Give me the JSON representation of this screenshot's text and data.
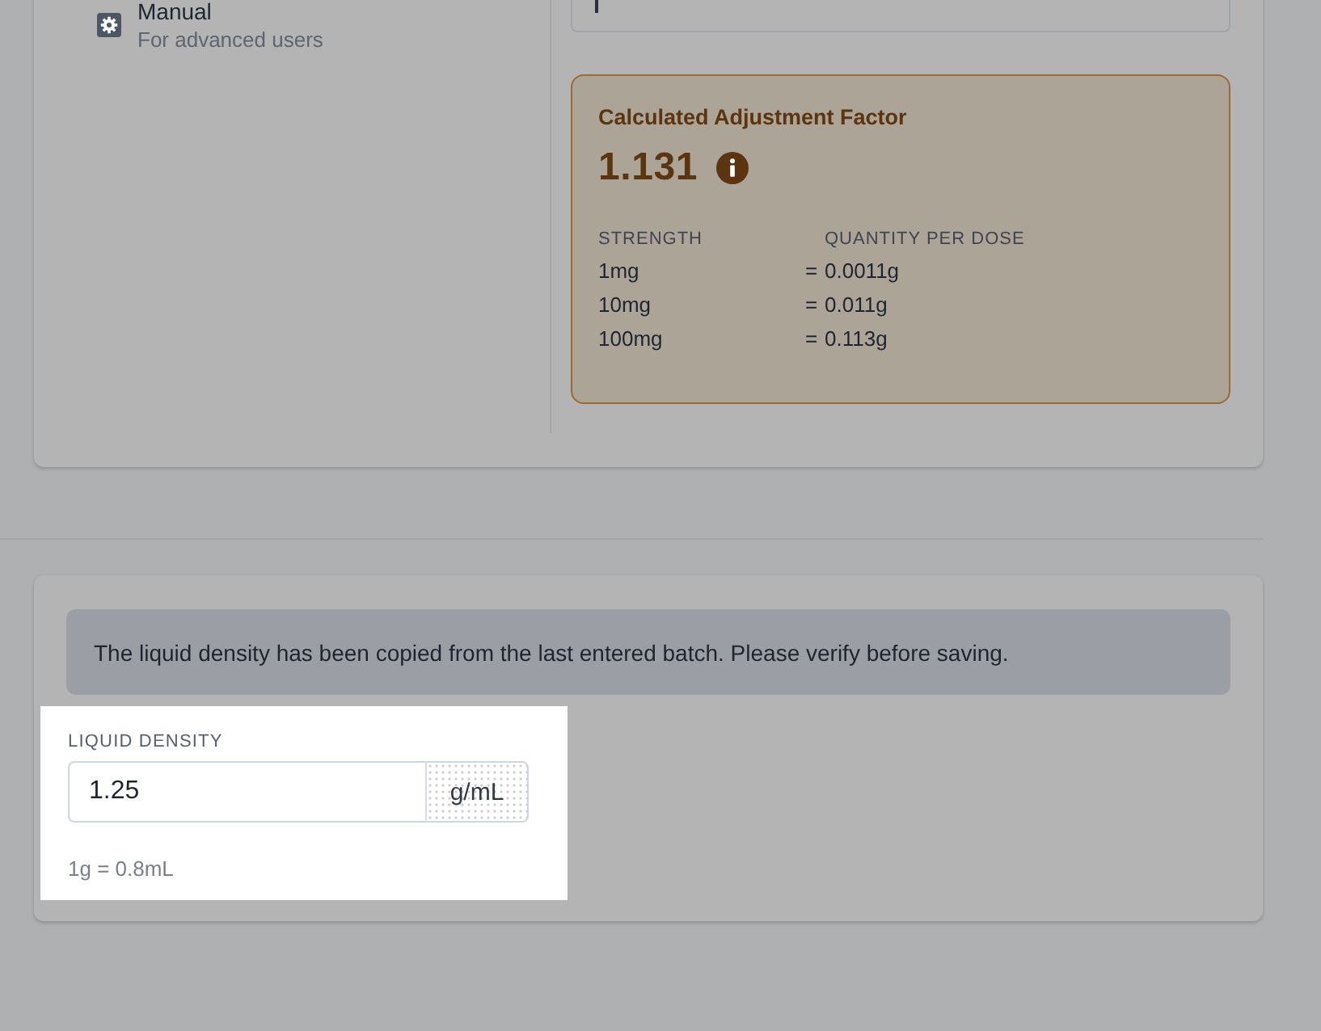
{
  "options": [
    {
      "label": "Manual",
      "description": "For advanced users"
    }
  ],
  "adjustment_factor": {
    "title": "Calculated Adjustment Factor",
    "value": "1.131",
    "table": {
      "columns": [
        "STRENGTH",
        "QUANTITY PER DOSE"
      ],
      "rows": [
        {
          "strength": "1mg",
          "operator": "=",
          "quantity": "0.0011g"
        },
        {
          "strength": "10mg",
          "operator": "=",
          "quantity": "0.011g"
        },
        {
          "strength": "100mg",
          "operator": "=",
          "quantity": "0.113g"
        }
      ]
    }
  },
  "notice": {
    "text": "The liquid density has been copied from the last entered batch. Please verify before saving."
  },
  "liquid_density": {
    "label": "LIQUID DENSITY",
    "value": "1.25",
    "unit": "g/mL",
    "hint": "1g = 0.8mL",
    "highlighted": true
  }
}
